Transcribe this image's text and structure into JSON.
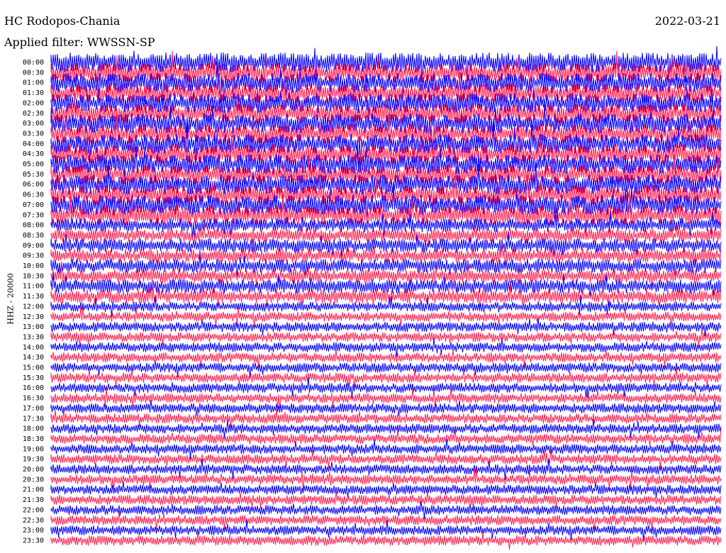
{
  "header": {
    "station": "HC Rodopos-Chania",
    "date": "2022-03-21",
    "filter": "Applied filter: WWSSN-SP"
  },
  "channel_label": "HHZ - 20000",
  "colors": {
    "trace_a": "#0000ff",
    "trace_b": "#ff1f4f",
    "background": "#ffffff"
  },
  "chart_data": {
    "type": "line",
    "title": "HC Rodopos-Chania",
    "ylabel": "HHZ - 20000",
    "row_labels": [
      "00:00",
      "00:30",
      "01:00",
      "01:30",
      "02:00",
      "02:30",
      "03:00",
      "03:30",
      "04:00",
      "04:30",
      "05:00",
      "05:30",
      "06:00",
      "06:30",
      "07:00",
      "07:30",
      "08:00",
      "08:30",
      "09:00",
      "09:30",
      "10:00",
      "10:30",
      "11:00",
      "11:30",
      "12:00",
      "12:30",
      "13:00",
      "13:30",
      "14:00",
      "14:30",
      "15:00",
      "15:30",
      "16:00",
      "16:30",
      "17:00",
      "17:30",
      "18:00",
      "18:30",
      "19:00",
      "19:30",
      "20:00",
      "20:30",
      "21:00",
      "21:30",
      "22:00",
      "22:30",
      "23:00",
      "23:30"
    ],
    "legend": "none",
    "grid": false
  }
}
